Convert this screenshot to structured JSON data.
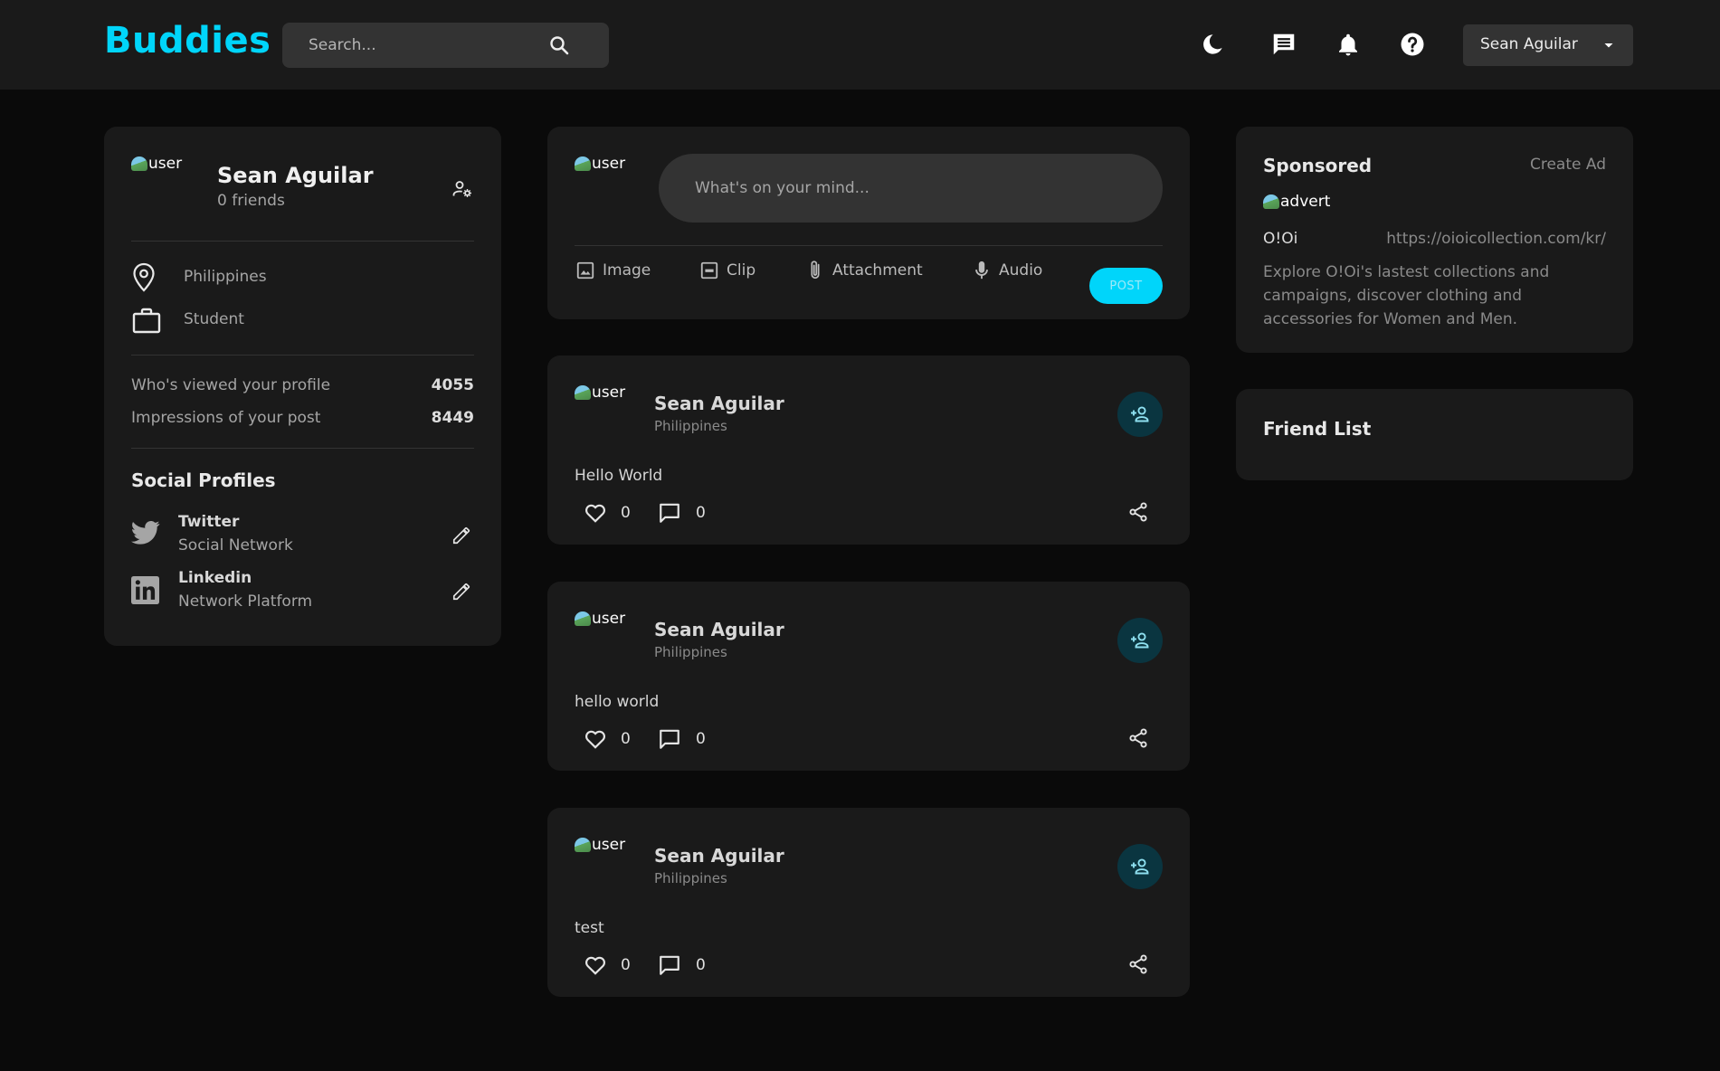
{
  "header": {
    "brand": "Buddies",
    "search_placeholder": "Search...",
    "user_menu_label": "Sean Aguilar"
  },
  "profile": {
    "avatar_alt": "user",
    "name": "Sean Aguilar",
    "friends": "0 friends",
    "location": "Philippines",
    "occupation": "Student",
    "stats": [
      {
        "label": "Who's viewed your profile",
        "value": "4055"
      },
      {
        "label": "Impressions of your post",
        "value": "8449"
      }
    ],
    "social_title": "Social Profiles",
    "social": [
      {
        "name": "Twitter",
        "sub": "Social Network"
      },
      {
        "name": "Linkedin",
        "sub": "Network Platform"
      }
    ]
  },
  "composer": {
    "avatar_alt": "user",
    "placeholder": "What's on your mind...",
    "actions": [
      "Image",
      "Clip",
      "Attachment",
      "Audio"
    ],
    "post_label": "POST"
  },
  "posts": [
    {
      "avatar_alt": "user",
      "name": "Sean Aguilar",
      "location": "Philippines",
      "text": "Hello World",
      "likes": "0",
      "comments": "0"
    },
    {
      "avatar_alt": "user",
      "name": "Sean Aguilar",
      "location": "Philippines",
      "text": "hello world",
      "likes": "0",
      "comments": "0"
    },
    {
      "avatar_alt": "user",
      "name": "Sean Aguilar",
      "location": "Philippines",
      "text": "test",
      "likes": "0",
      "comments": "0"
    }
  ],
  "sponsored": {
    "title": "Sponsored",
    "create_ad": "Create Ad",
    "image_alt": "advert",
    "name": "O!Oi",
    "url": "https://oioicollection.com/kr/",
    "description": "Explore O!Oi's lastest collections and campaigns, discover clothing and accessories for Women and Men."
  },
  "friend_list": {
    "title": "Friend List"
  },
  "colors": {
    "accent": "#00d5fa",
    "background": "#0a0a0a",
    "card": "#1a1a1a",
    "input": "#333333"
  },
  "icons": [
    "search-icon",
    "moon-icon",
    "message-icon",
    "bell-icon",
    "help-icon",
    "caret-down-icon",
    "manage-account-icon",
    "location-icon",
    "briefcase-icon",
    "twitter-icon",
    "linkedin-icon",
    "edit-icon",
    "image-icon",
    "gif-icon",
    "paperclip-icon",
    "microphone-icon",
    "add-friend-icon",
    "heart-icon",
    "comment-icon",
    "share-icon"
  ]
}
